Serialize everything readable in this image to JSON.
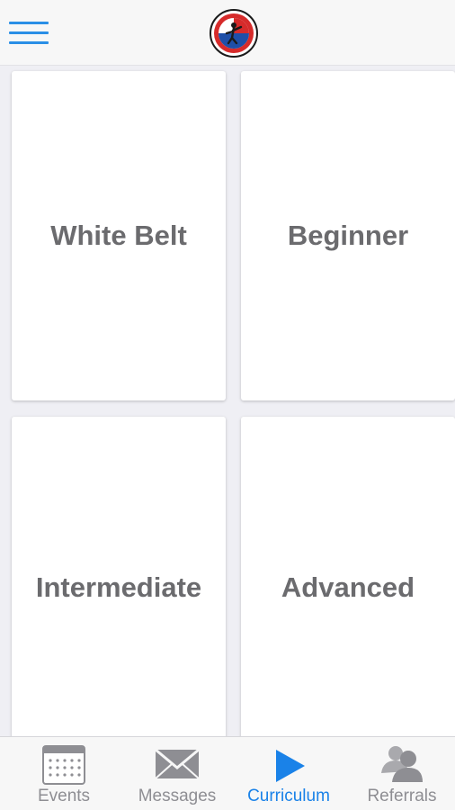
{
  "header": {
    "menu_icon": "hamburger-menu-icon",
    "logo_icon": "karate-academy-logo",
    "accent_color": "#2a8fe6"
  },
  "curriculum": {
    "cards": [
      {
        "label": "White Belt"
      },
      {
        "label": "Beginner"
      },
      {
        "label": "Intermediate"
      },
      {
        "label": "Advanced"
      }
    ]
  },
  "tabbar": {
    "active_color": "#1a82e8",
    "inactive_color": "#8e8e93",
    "tabs": [
      {
        "label": "Events",
        "icon": "calendar-icon",
        "active": false
      },
      {
        "label": "Messages",
        "icon": "envelope-icon",
        "active": false
      },
      {
        "label": "Curriculum",
        "icon": "play-icon",
        "active": true
      },
      {
        "label": "Referrals",
        "icon": "people-icon",
        "active": false
      }
    ]
  }
}
